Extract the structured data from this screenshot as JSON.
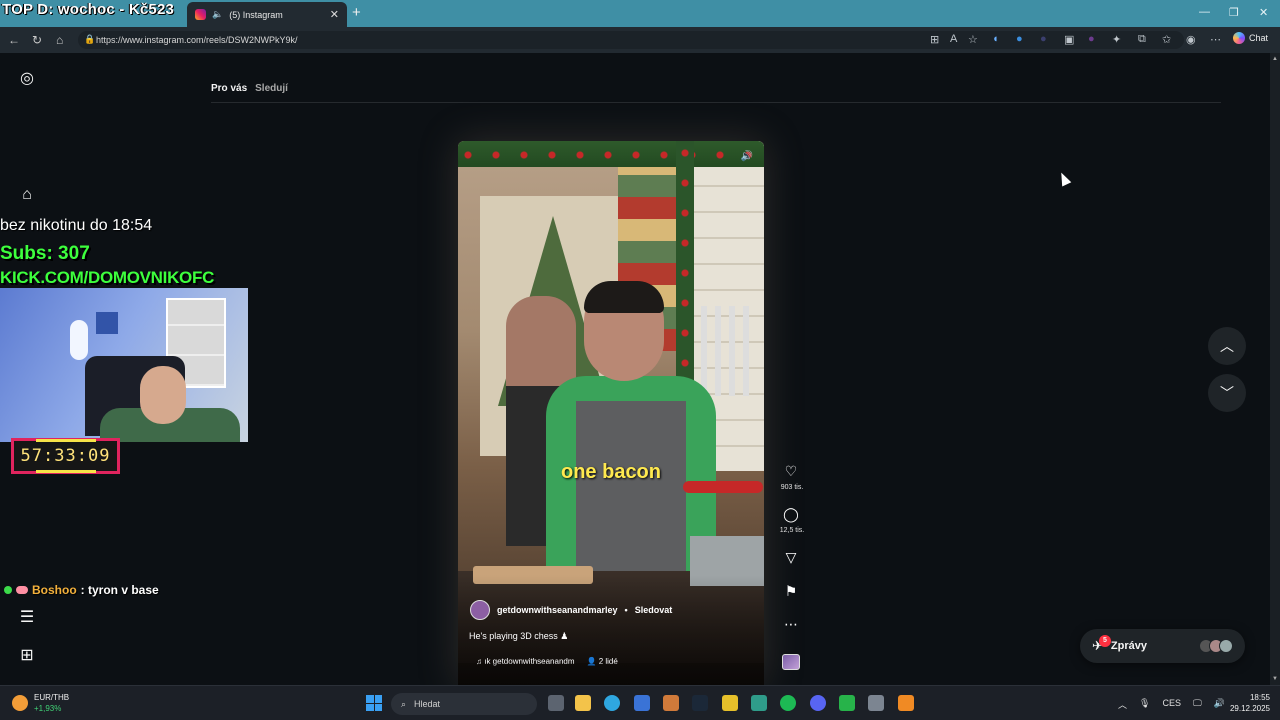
{
  "browser": {
    "tab_title": "(5) Instagram",
    "new_tab": "+",
    "url": "https://www.instagram.com/reels/DSW2NWPkY9k/",
    "chat_label": "Chat",
    "window_controls": [
      "—",
      "❐",
      "✕"
    ]
  },
  "stream": {
    "title": "TOP D: wochoc - Kč523",
    "nicotine": "bez nikotinu do 18:54",
    "subs": "Subs: 307",
    "kick": "KICK.COM/DOMOVNIKOFC",
    "timer": "57:33:09",
    "chat": {
      "user": "Boshoo",
      "message": ": tyron v base"
    }
  },
  "instagram": {
    "feed_tabs": {
      "active": "Pro vás",
      "inactive": "Sledují"
    },
    "reel": {
      "caption_text": "one bacon",
      "author": "getdownwithseanandmarley",
      "follow": "Sledovat",
      "description": "He's playing 3D chess ♟",
      "audio": "♫ ık  getdownwithseanandm",
      "people": "2 lidé",
      "dot_sep": "•"
    },
    "actions": {
      "likes": "903 tis.",
      "comments": "12,5 tis."
    },
    "messages": {
      "label": "Zprávy",
      "badge": "5"
    }
  },
  "taskbar": {
    "weather_title": "EUR/THB",
    "weather_change": "+1,93%",
    "search_placeholder": "Hledat",
    "lang": "CES",
    "time": "18:55",
    "date": "29.12.2025"
  },
  "colors": {
    "accent_blue": "#3f8fa5",
    "subs_green": "#3dff3d",
    "timer_border": "#e0245e",
    "caption_yellow": "#ffe94f"
  }
}
